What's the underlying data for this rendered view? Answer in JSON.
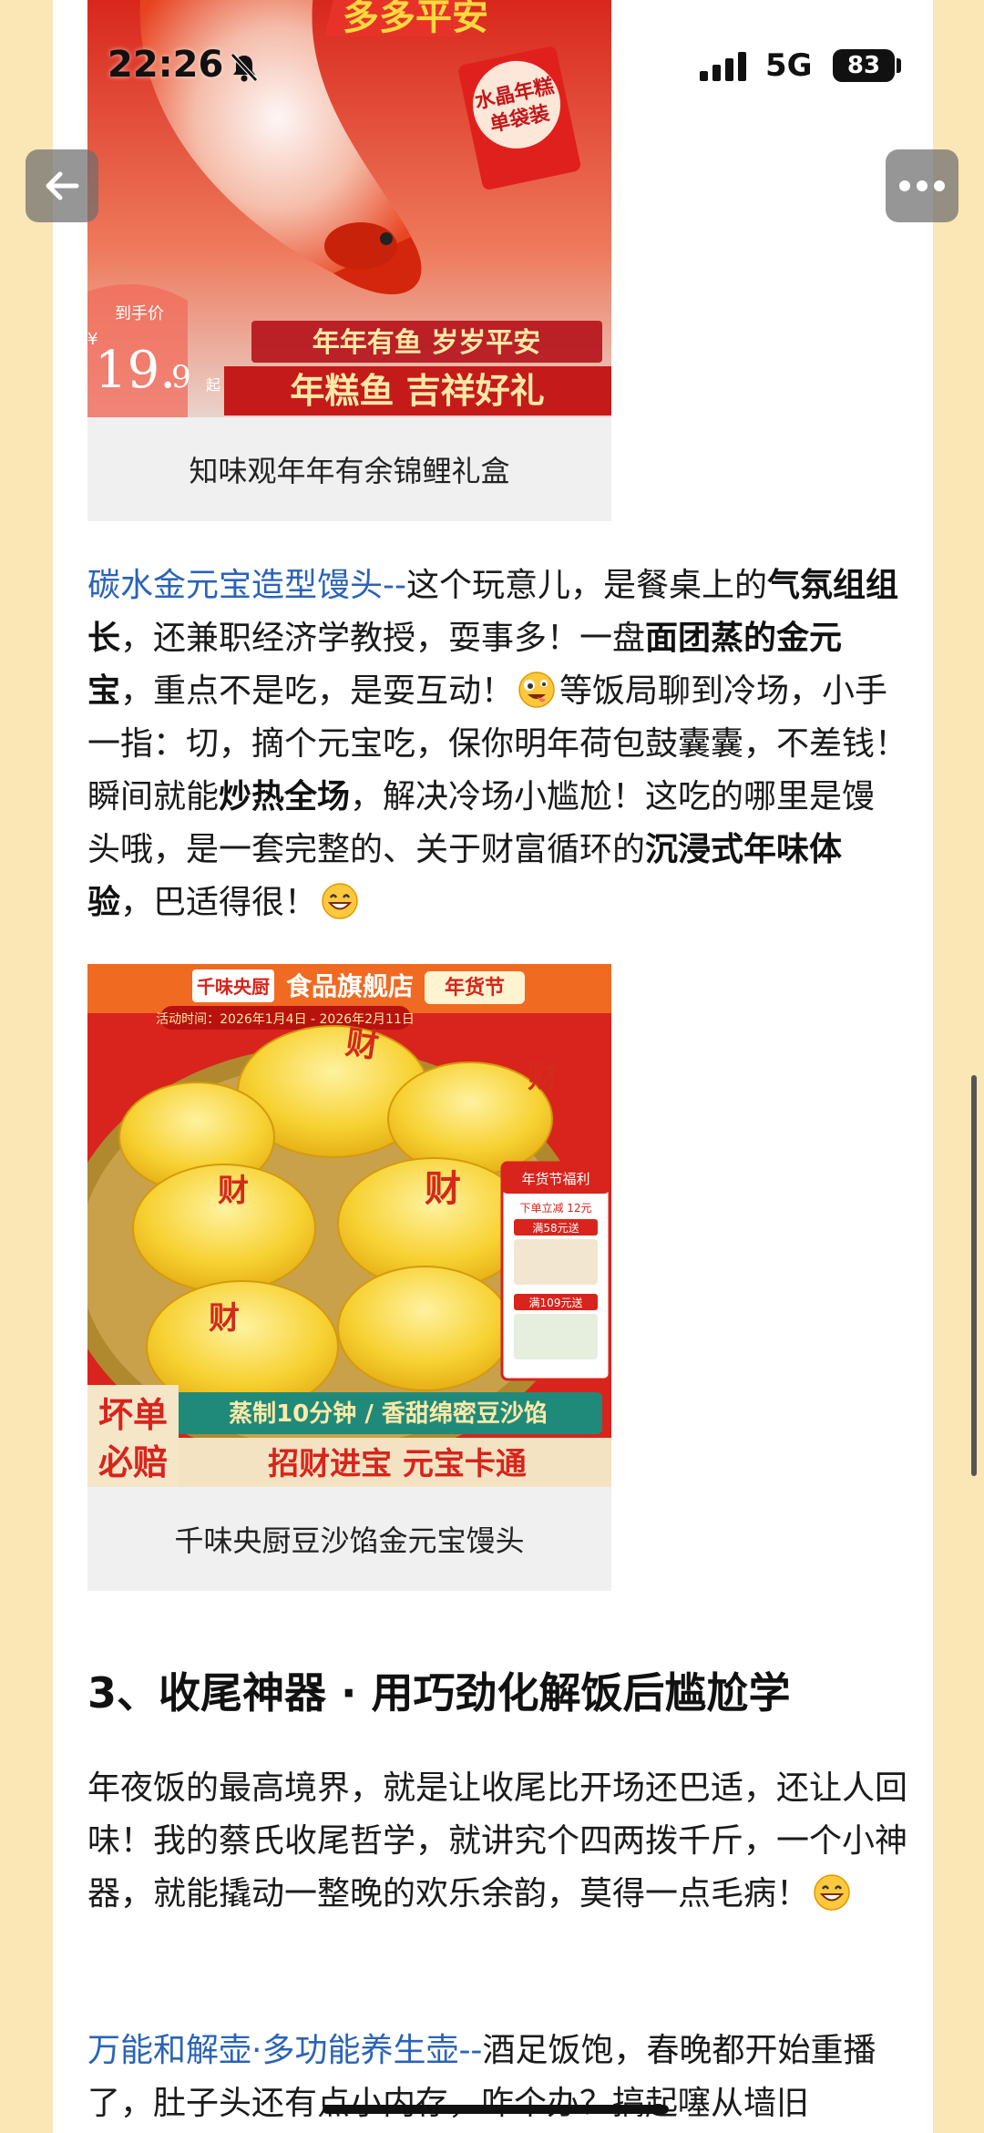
{
  "status_bar": {
    "time": "22:26",
    "network": "5G",
    "battery": "83"
  },
  "koi_image": {
    "banner_top": "多多平安",
    "badge_line1": "水晶年糕",
    "badge_line2": "单袋装",
    "price_label": "到手价",
    "price_currency": "¥",
    "price_main": "19.",
    "price_decimal": "9",
    "price_suffix": "起",
    "slogan1": "年年有鱼 岁岁平安",
    "slogan2": "年糕鱼 吉祥好礼",
    "caption": "知味观年年有余锦鲤礼盒"
  },
  "paragraph1": {
    "link": "碳水金元宝造型馒头--",
    "t1": "这个玩意儿，是餐桌上的",
    "b1": "气氛组组长",
    "t2": "，还兼职经济学教授，耍事多！一盘",
    "b2": "面团蒸的金元宝",
    "t3": "，重点不是吃，是耍互动！",
    "t4": "等饭局聊到冷场，小手一指：切，摘个元宝吃，保你明年荷包鼓囊囊，不差钱！瞬间就能",
    "b3": "炒热全场",
    "t5": "，解决冷场小尴尬！这吃的哪里是馒头哦，是一套完整的、关于财富循环的",
    "b4": "沉浸式年味体验",
    "t6": "，巴适得很！"
  },
  "bun_image": {
    "brand": "千味央厨",
    "store": "食品旗舰店",
    "festival": "年货节",
    "activity_time": "活动时间：2026年1月4日 - 2026年2月11日",
    "stamp": "财",
    "promo_title": "年货节福利",
    "promo_line1": "下单立减 12元",
    "promo_line2": "满58元送",
    "promo_line3": "满109元送",
    "feature": "蒸制10分钟 / 香甜绵密豆沙馅",
    "left_badge_top": "坏单",
    "left_badge_bottom": "必赔",
    "slogan": "招财进宝 元宝卡通",
    "caption": "千味央厨豆沙馅金元宝馒头"
  },
  "section3": {
    "heading": "3、收尾神器 · 用巧劲化解饭后尴尬学"
  },
  "paragraph2": {
    "text": "年夜饭的最高境界，就是让收尾比开场还巴适，还让人回味！我的蔡氏收尾哲学，就讲究个四两拨千斤，一个小神器，就能撬动一整晚的欢乐余韵，莫得一点毛病！"
  },
  "paragraph3": {
    "link": "万能和解壶·多功能养生壶--",
    "text": "酒足饭饱，春晚都开始重播了，肚子头还有点小内存，咋个办？搞起噻从墙旧"
  },
  "colors": {
    "link": "#2a63b8",
    "page_bg": "#fbe6b6",
    "caption_bg": "#f0f0f0",
    "festive_red": "#d42a1e",
    "gold": "#f5c531"
  },
  "icons": [
    "back-arrow-icon",
    "more-dots-icon",
    "bell-off-icon",
    "signal-icon",
    "battery-icon",
    "crazy-face-emoji",
    "grin-emoji"
  ]
}
